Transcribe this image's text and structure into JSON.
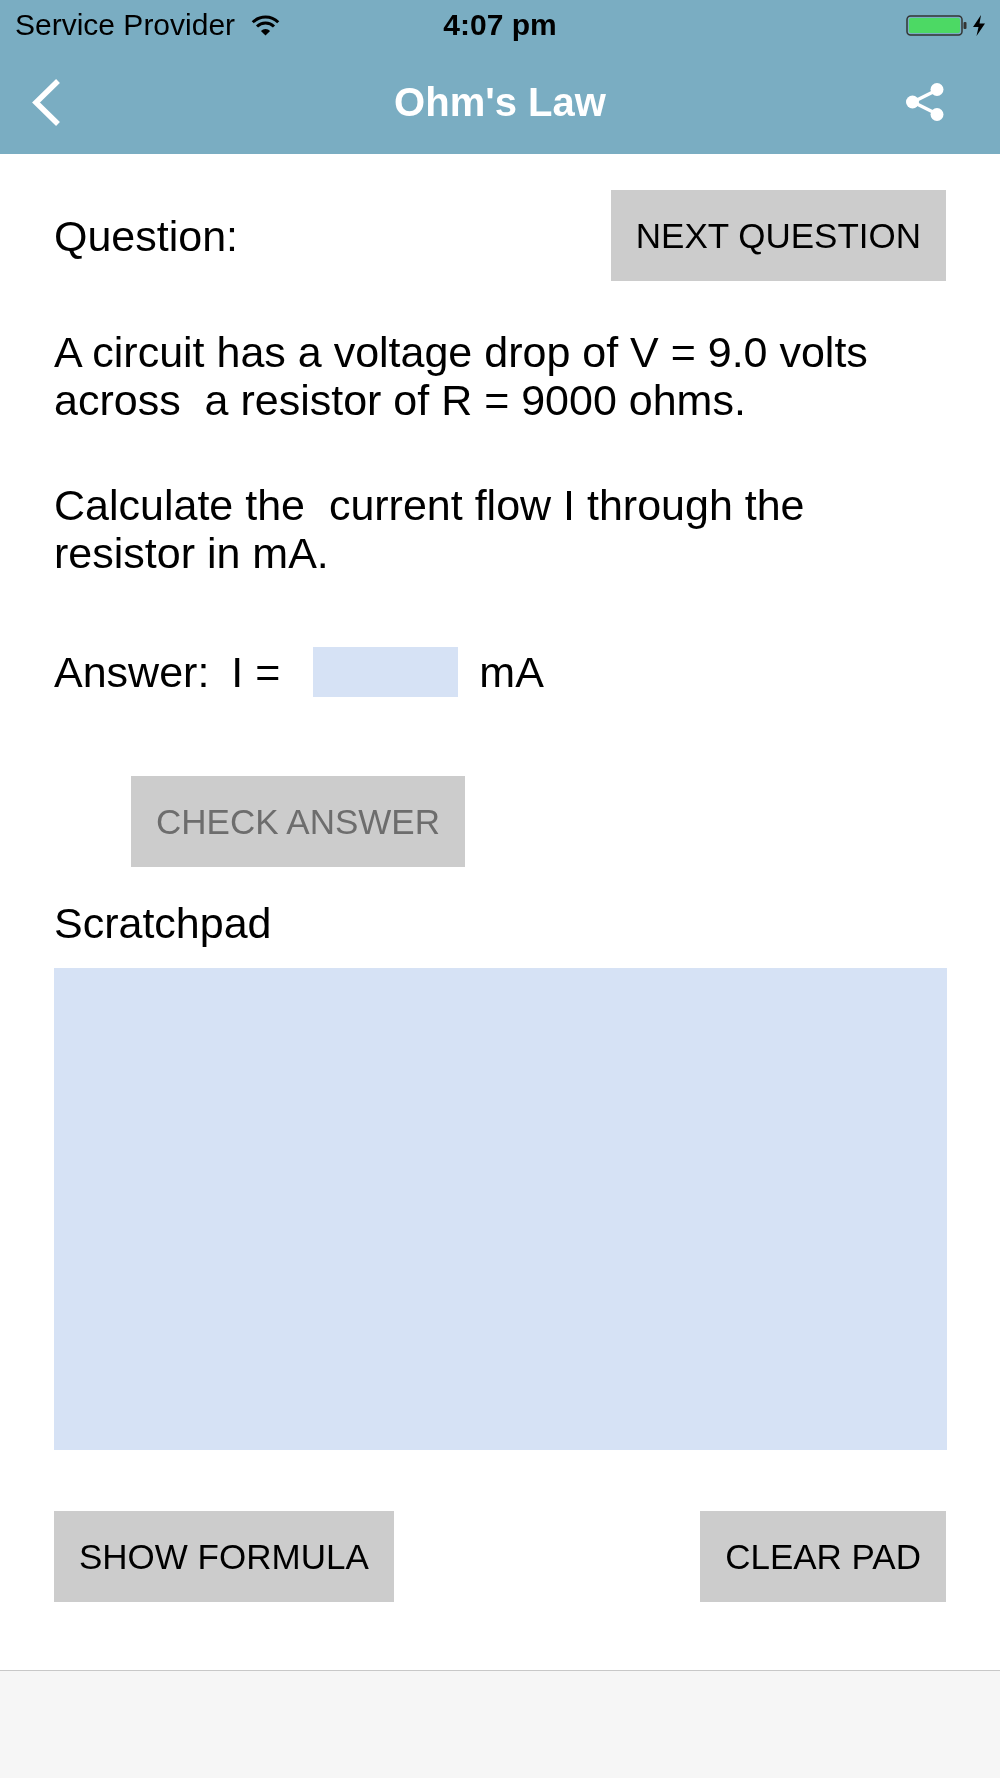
{
  "status_bar": {
    "carrier": "Service Provider",
    "time": "4:07 pm"
  },
  "nav_bar": {
    "title": "Ohm's Law"
  },
  "question": {
    "label": "Question:",
    "next_button": {
      "label": "NEXT QUESTION",
      "disabled": false
    },
    "paragraphs": [
      "A circuit has a voltage drop of V = 9.0 volts across  a resistor of R = 9000 ohms.",
      "Calculate the  current flow I through the resistor in mA."
    ]
  },
  "answer": {
    "label": "Answer:",
    "variable": "I =",
    "unit": "mA"
  },
  "check_button": {
    "label": "CHECK ANSWER",
    "disabled": true
  },
  "scratchpad": {
    "label": "Scratchpad"
  },
  "buttons": [
    {
      "label": "SHOW FORMULA",
      "disabled": false
    },
    {
      "label": "CLEAR PAD",
      "disabled": false
    }
  ]
}
